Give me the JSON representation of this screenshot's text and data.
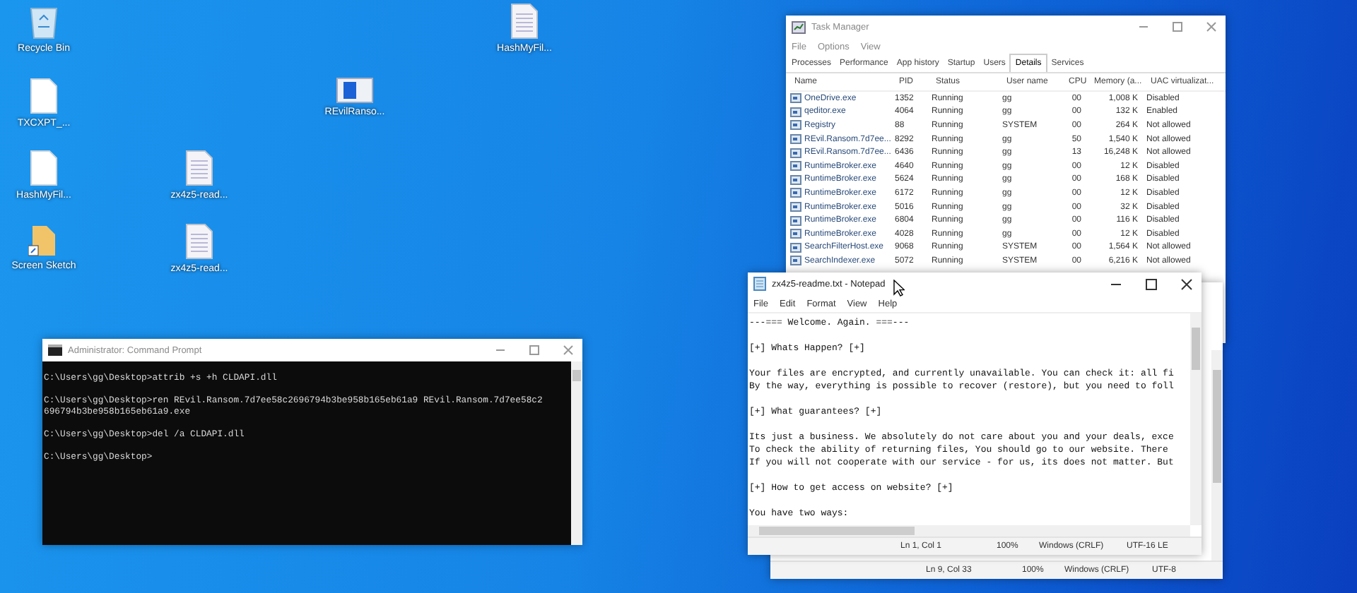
{
  "desktop_icons": [
    {
      "label": "Recycle Bin",
      "kind": "recycle"
    },
    {
      "label": "TXCXPT_...",
      "kind": "file"
    },
    {
      "label": "HashMyFil...",
      "kind": "file"
    },
    {
      "label": "Screen Sketch",
      "kind": "shortcut"
    },
    {
      "label": "zx4z5-read...",
      "kind": "doc"
    },
    {
      "label": "zx4z5-read...",
      "kind": "doc"
    },
    {
      "label": "REvilRanso...",
      "kind": "app"
    },
    {
      "label": "HashMyFil...",
      "kind": "doc"
    }
  ],
  "task_manager": {
    "title": "Task Manager",
    "menu": [
      "File",
      "Options",
      "View"
    ],
    "tabs": [
      {
        "label": "Processes",
        "selected": false
      },
      {
        "label": "Performance",
        "selected": false
      },
      {
        "label": "App history",
        "selected": false
      },
      {
        "label": "Startup",
        "selected": false
      },
      {
        "label": "Users",
        "selected": false
      },
      {
        "label": "Details",
        "selected": true
      },
      {
        "label": "Services",
        "selected": false
      }
    ],
    "columns": [
      "Name",
      "PID",
      "Status",
      "User name",
      "CPU",
      "Memory (a...",
      "UAC virtualizat..."
    ],
    "rows": [
      [
        "OneDrive.exe",
        "1352",
        "Running",
        "gg",
        "00",
        "1,008 K",
        "Disabled"
      ],
      [
        "qeditor.exe",
        "4064",
        "Running",
        "gg",
        "00",
        "132 K",
        "Enabled"
      ],
      [
        "Registry",
        "88",
        "Running",
        "SYSTEM",
        "00",
        "264 K",
        "Not allowed"
      ],
      [
        "REvil.Ransom.7d7ee...",
        "8292",
        "Running",
        "gg",
        "50",
        "1,540 K",
        "Not allowed"
      ],
      [
        "REvil.Ransom.7d7ee...",
        "6436",
        "Running",
        "gg",
        "13",
        "16,248 K",
        "Not allowed"
      ],
      [
        "RuntimeBroker.exe",
        "4640",
        "Running",
        "gg",
        "00",
        "12 K",
        "Disabled"
      ],
      [
        "RuntimeBroker.exe",
        "5624",
        "Running",
        "gg",
        "00",
        "168 K",
        "Disabled"
      ],
      [
        "RuntimeBroker.exe",
        "6172",
        "Running",
        "gg",
        "00",
        "12 K",
        "Disabled"
      ],
      [
        "RuntimeBroker.exe",
        "5016",
        "Running",
        "gg",
        "00",
        "32 K",
        "Disabled"
      ],
      [
        "RuntimeBroker.exe",
        "6804",
        "Running",
        "gg",
        "00",
        "116 K",
        "Disabled"
      ],
      [
        "RuntimeBroker.exe",
        "4028",
        "Running",
        "gg",
        "00",
        "12 K",
        "Disabled"
      ],
      [
        "SearchFilterHost.exe",
        "9068",
        "Running",
        "SYSTEM",
        "00",
        "1,564 K",
        "Not allowed"
      ],
      [
        "SearchIndexer.exe",
        "5072",
        "Running",
        "SYSTEM",
        "00",
        "6,216 K",
        "Not allowed"
      ]
    ]
  },
  "command_prompt": {
    "title": "Administrator: Command Prompt",
    "blocks": [
      [
        "C:\\Users\\gg\\Desktop>attrib +s +h CLDAPI.dll"
      ],
      [
        "C:\\Users\\gg\\Desktop>ren REvil.Ransom.7d7ee58c2696794b3be958b165eb61a9 REvil.Ransom.7d7ee58c2",
        "696794b3be958b165eb61a9.exe"
      ],
      [
        "C:\\Users\\gg\\Desktop>del /a CLDAPI.dll"
      ],
      [
        "C:\\Users\\gg\\Desktop>"
      ]
    ]
  },
  "notepad_back": {
    "status": [
      "Ln 9, Col 33",
      "100%",
      "Windows (CRLF)",
      "UTF-8"
    ]
  },
  "notepad": {
    "title": "zx4z5-readme.txt - Notepad",
    "menu": [
      "File",
      "Edit",
      "Format",
      "View",
      "Help"
    ],
    "blocks": [
      [
        "---=== Welcome. Again. ===---"
      ],
      [
        "[+] Whats Happen? [+]"
      ],
      [
        "Your files are encrypted, and currently unavailable. You can check it: all fi",
        "By the way, everything is possible to recover (restore), but you need to foll"
      ],
      [
        "[+] What guarantees? [+]"
      ],
      [
        "Its just a business. We absolutely do not care about you and your deals, exce",
        "To check the ability of returning files, You should go to our website. There",
        "If you will not cooperate with our service - for us, its does not matter. But"
      ],
      [
        "[+] How to get access on website? [+]"
      ],
      [
        "You have two ways:"
      ]
    ],
    "status": [
      "Ln 1, Col 1",
      "100%",
      "Windows (CRLF)",
      "UTF-16 LE"
    ]
  }
}
